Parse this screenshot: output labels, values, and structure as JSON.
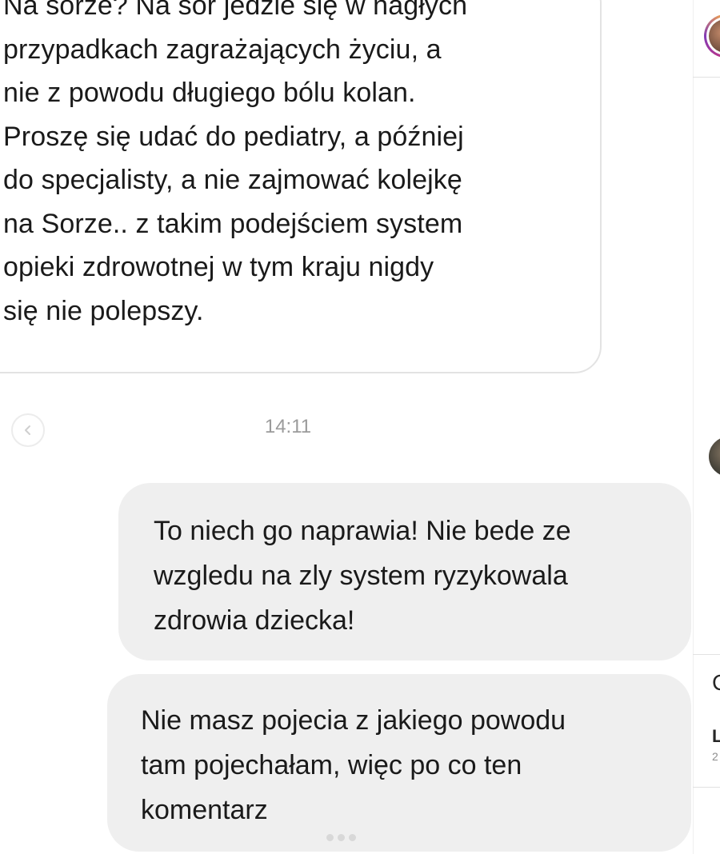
{
  "conversation": {
    "incoming_message": "Na sorze? Na sor jedzie się w nagłych\nprzypadkach zagrażających życiu, a\nnie z powodu długiego bólu kolan.\nProszę się udać do pediatry, a później\ndo specjalisty, a nie zajmować kolejkę\nna Sorze.. z takim podejściem system\nopieki zdrowotnej w tym kraju nigdy\nsię nie polepszy.",
    "timestamp": "14:11",
    "outgoing_messages": [
      "To niech go naprawia! Nie bede ze\nwzgledu na zly system ryzykowala\nzdrowia dziecka!",
      "Nie masz pojecia z jakiego powodu\ntam pojechałam, więc po co ten\nkomentarz"
    ]
  },
  "icons": {
    "back": "chevron-left-icon"
  },
  "sidebar_peek": {
    "letter_1": "C",
    "letter_2": "L",
    "letter_3": "2"
  }
}
